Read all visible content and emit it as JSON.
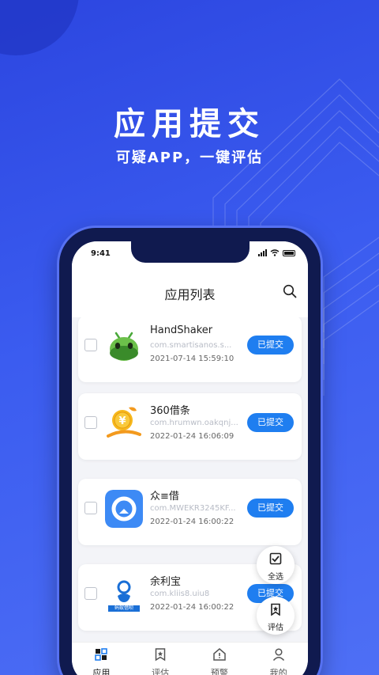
{
  "hero": {
    "title": "应用提交",
    "subtitle": "可疑APP，一键评估"
  },
  "status_bar": {
    "time": "9:41"
  },
  "header": {
    "title": "应用列表",
    "search_icon": "search-icon"
  },
  "apps": [
    {
      "name": "HandShaker",
      "package": "com.smartisanos.s...",
      "date": "2021-07-14 15:59:10",
      "status": "已提交",
      "icon": "android-robot-icon"
    },
    {
      "name": "360借条",
      "package": "com.hrumwn.oakqnj...",
      "date": "2022-01-24 16:06:09",
      "status": "已提交",
      "icon": "yuan-coin-icon"
    },
    {
      "name": "众≡借",
      "package": "com.MWEKR3245KF...",
      "date": "2022-01-24 16:00:22",
      "status": "已提交",
      "icon": "blue-circle-app-icon"
    },
    {
      "name": "余利宝",
      "package": "com.kliis8.uiu8",
      "date": "2022-01-24 16:00:22",
      "status": "已提交",
      "icon": "ant-app-icon",
      "icon_caption": "蚂蚁借呗"
    }
  ],
  "fab": {
    "select_all": "全选",
    "evaluate": "评估"
  },
  "tabs": [
    {
      "label": "应用",
      "icon": "apps-grid-icon",
      "active": true
    },
    {
      "label": "评估",
      "icon": "bookmark-star-icon",
      "active": false
    },
    {
      "label": "预警",
      "icon": "alert-house-icon",
      "active": false
    },
    {
      "label": "我的",
      "icon": "person-icon",
      "active": false
    }
  ],
  "colors": {
    "background": "#3a55e8",
    "accent": "#1f7ef0",
    "phone_frame": "#101a4f"
  }
}
